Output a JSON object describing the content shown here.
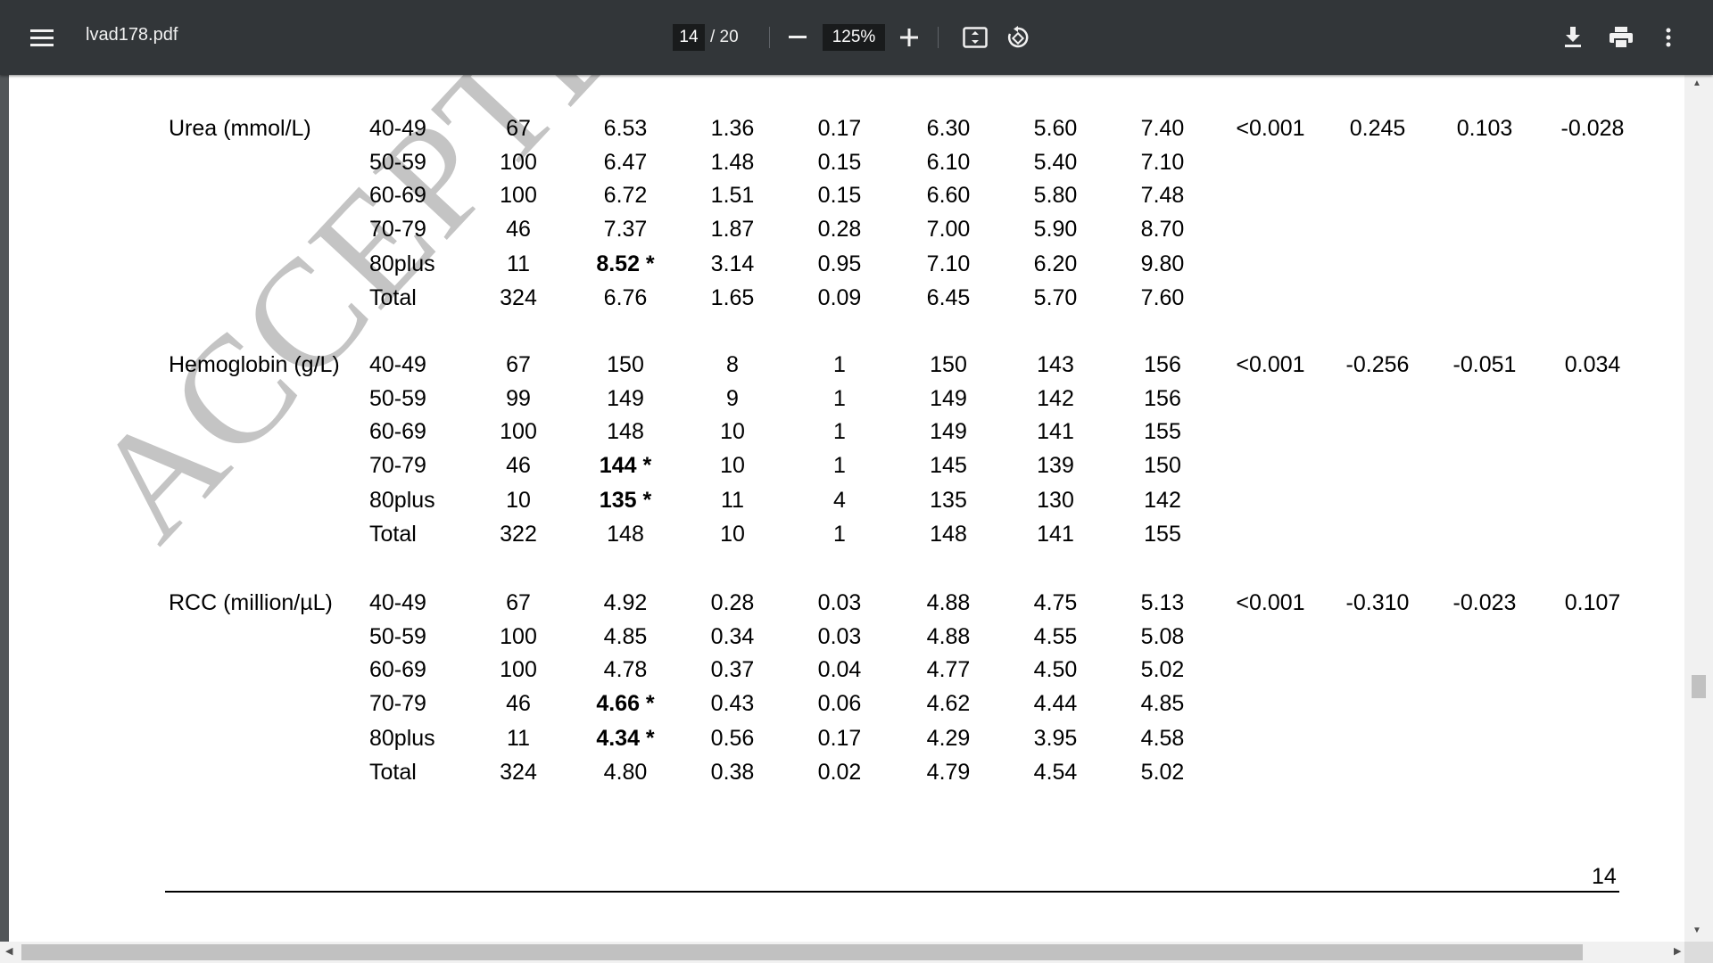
{
  "toolbar": {
    "menu_icon": "hamburger-icon",
    "filename": "lvad178.pdf",
    "page_current": "14",
    "page_total": "/ 20",
    "zoom": "125%",
    "icons": [
      "minus-icon",
      "plus-icon",
      "fit-page-icon",
      "rotate-icon",
      "download-icon",
      "print-icon",
      "more-vert-icon"
    ]
  },
  "document": {
    "watermark": "ACCEPTED MA",
    "page_number": "14",
    "groups": [
      {
        "label": "Urea (mmol/L)",
        "p_value": "<0.001",
        "r1": "0.245",
        "r2": "0.103",
        "r3": "-0.028",
        "rows": [
          {
            "age": "40-49",
            "n": "67",
            "mean": "6.53",
            "sd": "1.36",
            "se": "0.17",
            "median": "6.30",
            "q1": "5.60",
            "q3": "7.40",
            "bold": false
          },
          {
            "age": "50-59",
            "n": "100",
            "mean": "6.47",
            "sd": "1.48",
            "se": "0.15",
            "median": "6.10",
            "q1": "5.40",
            "q3": "7.10",
            "bold": false
          },
          {
            "age": "60-69",
            "n": "100",
            "mean": "6.72",
            "sd": "1.51",
            "se": "0.15",
            "median": "6.60",
            "q1": "5.80",
            "q3": "7.48",
            "bold": false
          },
          {
            "age": "70-79",
            "n": "46",
            "mean": "7.37",
            "sd": "1.87",
            "se": "0.28",
            "median": "7.00",
            "q1": "5.90",
            "q3": "8.70",
            "bold": false
          },
          {
            "age": "80plus",
            "n": "11",
            "mean": "8.52 *",
            "sd": "3.14",
            "se": "0.95",
            "median": "7.10",
            "q1": "6.20",
            "q3": "9.80",
            "bold": true
          },
          {
            "age": "Total",
            "n": "324",
            "mean": "6.76",
            "sd": "1.65",
            "se": "0.09",
            "median": "6.45",
            "q1": "5.70",
            "q3": "7.60",
            "bold": false
          }
        ]
      },
      {
        "label": "Hemoglobin (g/L)",
        "p_value": "<0.001",
        "r1": "-0.256",
        "r2": "-0.051",
        "r3": "0.034",
        "rows": [
          {
            "age": "40-49",
            "n": "67",
            "mean": "150",
            "sd": "8",
            "se": "1",
            "median": "150",
            "q1": "143",
            "q3": "156",
            "bold": false
          },
          {
            "age": "50-59",
            "n": "99",
            "mean": "149",
            "sd": "9",
            "se": "1",
            "median": "149",
            "q1": "142",
            "q3": "156",
            "bold": false
          },
          {
            "age": "60-69",
            "n": "100",
            "mean": "148",
            "sd": "10",
            "se": "1",
            "median": "149",
            "q1": "141",
            "q3": "155",
            "bold": false
          },
          {
            "age": "70-79",
            "n": "46",
            "mean": "144 *",
            "sd": "10",
            "se": "1",
            "median": "145",
            "q1": "139",
            "q3": "150",
            "bold": true
          },
          {
            "age": "80plus",
            "n": "10",
            "mean": "135 *",
            "sd": "11",
            "se": "4",
            "median": "135",
            "q1": "130",
            "q3": "142",
            "bold": true
          },
          {
            "age": "Total",
            "n": "322",
            "mean": "148",
            "sd": "10",
            "se": "1",
            "median": "148",
            "q1": "141",
            "q3": "155",
            "bold": false
          }
        ]
      },
      {
        "label": "RCC (million/µL)",
        "p_value": "<0.001",
        "r1": "-0.310",
        "r2": "-0.023",
        "r3": "0.107",
        "rows": [
          {
            "age": "40-49",
            "n": "67",
            "mean": "4.92",
            "sd": "0.28",
            "se": "0.03",
            "median": "4.88",
            "q1": "4.75",
            "q3": "5.13",
            "bold": false
          },
          {
            "age": "50-59",
            "n": "100",
            "mean": "4.85",
            "sd": "0.34",
            "se": "0.03",
            "median": "4.88",
            "q1": "4.55",
            "q3": "5.08",
            "bold": false
          },
          {
            "age": "60-69",
            "n": "100",
            "mean": "4.78",
            "sd": "0.37",
            "se": "0.04",
            "median": "4.77",
            "q1": "4.50",
            "q3": "5.02",
            "bold": false
          },
          {
            "age": "70-79",
            "n": "46",
            "mean": "4.66 *",
            "sd": "0.43",
            "se": "0.06",
            "median": "4.62",
            "q1": "4.44",
            "q3": "4.85",
            "bold": true
          },
          {
            "age": "80plus",
            "n": "11",
            "mean": "4.34 *",
            "sd": "0.56",
            "se": "0.17",
            "median": "4.29",
            "q1": "3.95",
            "q3": "4.58",
            "bold": true
          },
          {
            "age": "Total",
            "n": "324",
            "mean": "4.80",
            "sd": "0.38",
            "se": "0.02",
            "median": "4.79",
            "q1": "4.54",
            "q3": "5.02",
            "bold": false
          }
        ]
      }
    ]
  }
}
